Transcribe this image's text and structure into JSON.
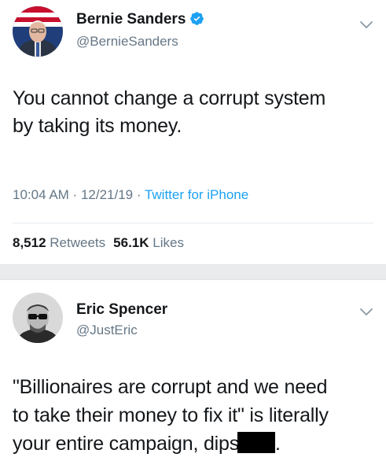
{
  "tweet1": {
    "name": "Bernie Sanders",
    "handle": "@BernieSanders",
    "verified": true,
    "text_line1": "You cannot change a corrupt system",
    "text_line2": "by taking its money.",
    "time": "10:04 AM",
    "sep1": " · ",
    "date": "12/21/19",
    "sep2": " · ",
    "source": "Twitter for iPhone",
    "retweets_count": "8,512",
    "retweets_label": "Retweets",
    "likes_count": "56.1K",
    "likes_label": "Likes",
    "icons": {
      "verified": "verified-badge-icon",
      "menu": "chevron-down-icon"
    }
  },
  "tweet2": {
    "name": "Eric Spencer",
    "handle": "@JustEric",
    "text_line1": "\"Billionaires are corrupt and we need",
    "text_line2": "to take their money to fix it\" is literally",
    "text_line3": "your entire campaign, dips",
    "text_line3_end": ".",
    "icons": {
      "menu": "chevron-down-icon"
    }
  },
  "colors": {
    "text": "#14171a",
    "secondary": "#657786",
    "link": "#1da1f2",
    "divider": "#e9ebed"
  }
}
